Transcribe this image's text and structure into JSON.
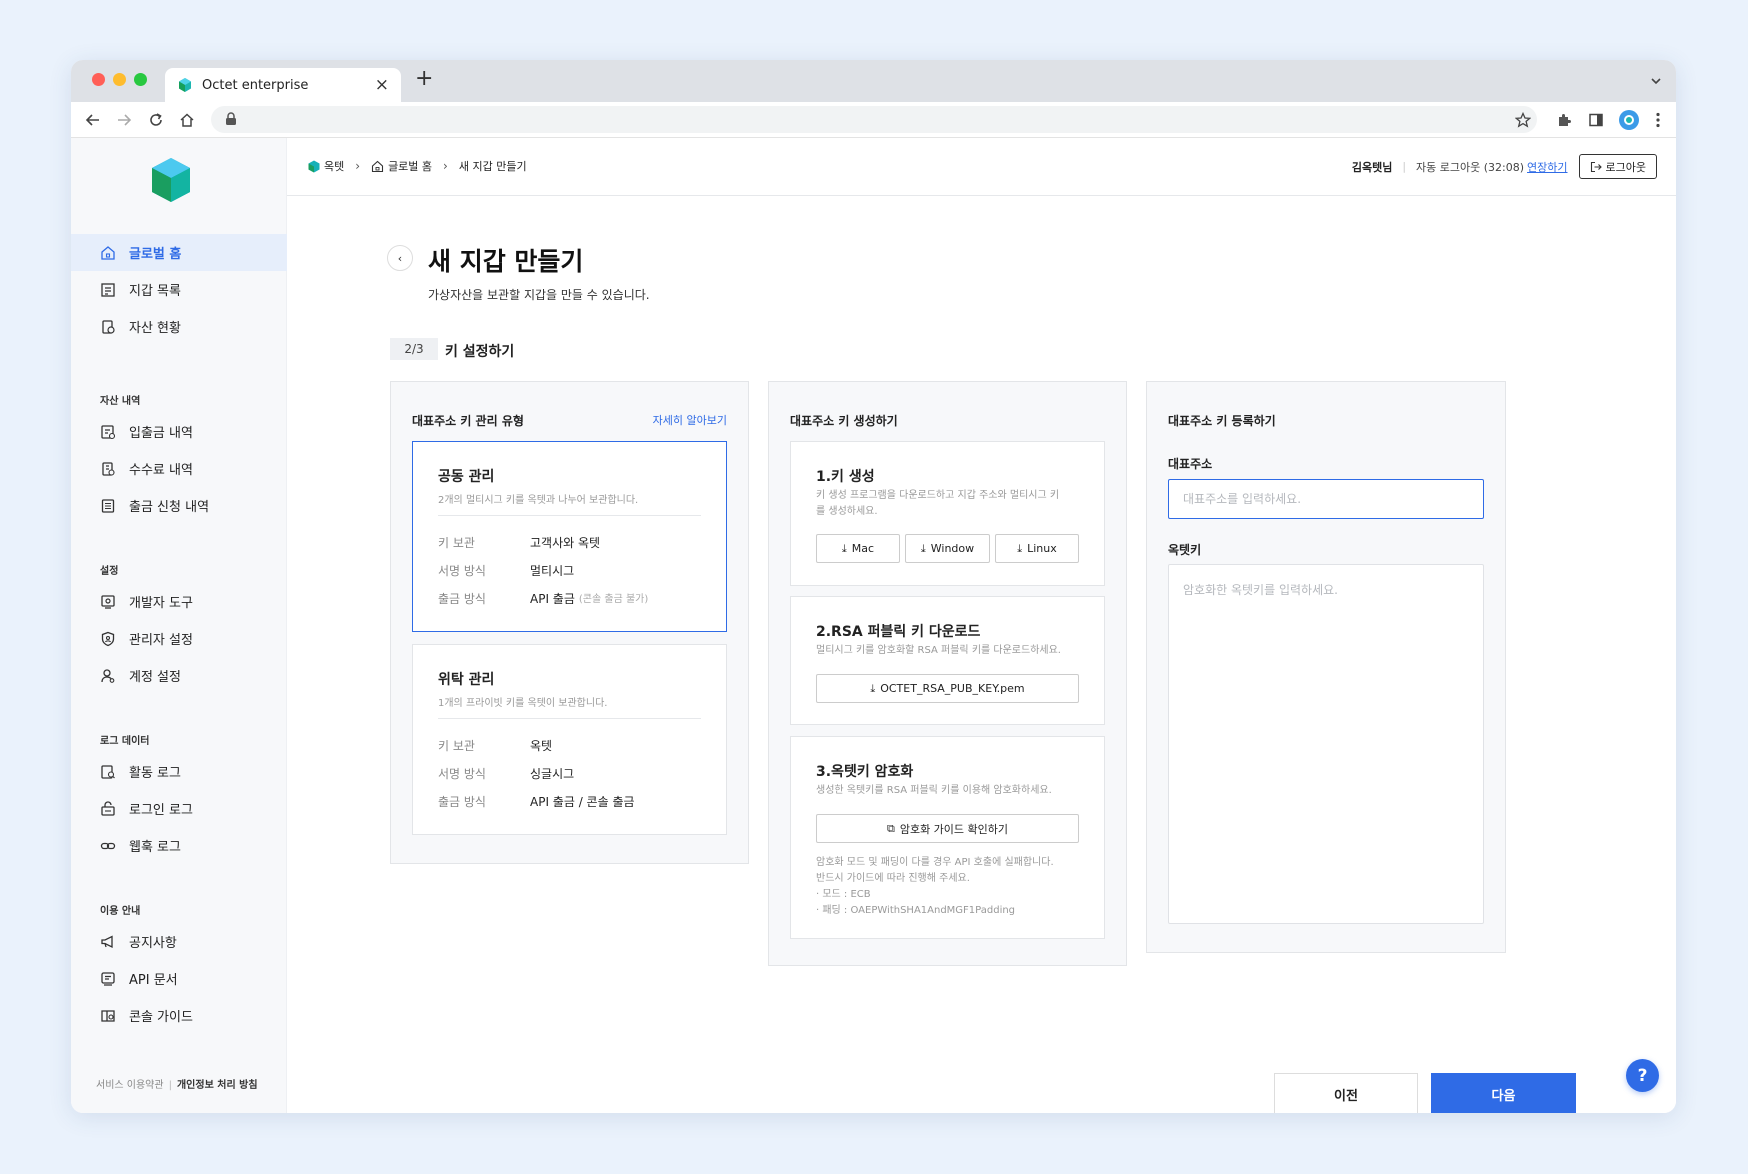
{
  "browser": {
    "tab_title": "Octet enterprise",
    "colors": {
      "close": "#ff5f57",
      "minimize": "#febc2e",
      "maximize": "#28c840"
    }
  },
  "sidebar": {
    "items_top": [
      {
        "label": "글로벌 홈",
        "icon": "home-icon",
        "active": true
      },
      {
        "label": "지갑 목록",
        "icon": "list-icon"
      },
      {
        "label": "자산 현황",
        "icon": "asset-icon"
      }
    ],
    "sections": [
      {
        "title": "자산 내역",
        "items": [
          {
            "label": "입출금 내역",
            "icon": "transfer-icon"
          },
          {
            "label": "수수료 내역",
            "icon": "fee-icon"
          },
          {
            "label": "출금 신청 내역",
            "icon": "request-icon"
          }
        ]
      },
      {
        "title": "설정",
        "items": [
          {
            "label": "개발자 도구",
            "icon": "developer-icon"
          },
          {
            "label": "관리자 설정",
            "icon": "shield-icon"
          },
          {
            "label": "계정 설정",
            "icon": "user-icon"
          }
        ]
      },
      {
        "title": "로그 데이터",
        "items": [
          {
            "label": "활동 로그",
            "icon": "activity-icon"
          },
          {
            "label": "로그인 로그",
            "icon": "login-icon"
          },
          {
            "label": "웹훅 로그",
            "icon": "link-icon"
          }
        ]
      },
      {
        "title": "이용 안내",
        "items": [
          {
            "label": "공지사항",
            "icon": "megaphone-icon"
          },
          {
            "label": "API 문서",
            "icon": "doc-icon"
          },
          {
            "label": "콘솔 가이드",
            "icon": "guide-icon"
          }
        ]
      }
    ],
    "footer": {
      "terms": "서비스 이용약관",
      "privacy": "개인정보 처리 방침"
    }
  },
  "topbar": {
    "breadcrumb": [
      "옥텟",
      "글로벌 홈",
      "새 지갑 만들기"
    ],
    "user_name": "김옥텟님",
    "auto_logout": "자동 로그아웃 (32:08)",
    "extend": "연장하기",
    "logout": "로그아웃"
  },
  "page": {
    "title": "새 지갑 만들기",
    "subtitle": "가상자산을 보관할 지갑을 만들 수 있습니다.",
    "step": "2/3",
    "step_title": "키 설정하기"
  },
  "panel1": {
    "title": "대표주소 키 관리 유형",
    "link": "자세히 알아보기",
    "cards": [
      {
        "title": "공동 관리",
        "desc": "2개의 멀티시그 키를 옥텟과 나누어 보관합니다.",
        "rows": [
          {
            "k": "키 보관",
            "v": "고객사와 옥텟",
            "note": ""
          },
          {
            "k": "서명 방식",
            "v": "멀티시그",
            "note": ""
          },
          {
            "k": "출금 방식",
            "v": "API 출금",
            "note": "(콘솔 출금 불가)"
          }
        ]
      },
      {
        "title": "위탁 관리",
        "desc": "1개의 프라이빗 키를 옥텟이 보관합니다.",
        "rows": [
          {
            "k": "키 보관",
            "v": "옥텟",
            "note": ""
          },
          {
            "k": "서명 방식",
            "v": "싱글시그",
            "note": ""
          },
          {
            "k": "출금 방식",
            "v": "API 출금 / 콘솔 출금",
            "note": ""
          }
        ]
      }
    ]
  },
  "panel2": {
    "title": "대표주소 키 생성하기",
    "step1": {
      "title": "1.키 생성",
      "desc1": "키 생성 프로그램을 다운로드하고 지갑 주소와 멀티시그 키",
      "desc2": "를 생성하세요.",
      "buttons": [
        "Mac",
        "Window",
        "Linux"
      ]
    },
    "step2": {
      "title": "2.RSA 퍼블릭 키 다운로드",
      "desc": "멀티시그 키를 암호화할 RSA 퍼블릭 키를 다운로드하세요.",
      "button": "OCTET_RSA_PUB_KEY.pem"
    },
    "step3": {
      "title": "3.옥텟키 암호화",
      "desc": "생성한 옥텟키를 RSA 퍼블릭 키를 이용해 암호화하세요.",
      "button": "암호화 가이드 확인하기",
      "notes": [
        "암호화 모드 및 패딩이 다를 경우 API 호출에 실패합니다.",
        "반드시 가이드에 따라 진행해 주세요.",
        "· 모드 : ECB",
        "· 패딩 : OAEPWithSHA1AndMGF1Padding"
      ]
    }
  },
  "panel3": {
    "title": "대표주소 키 등록하기",
    "address_label": "대표주소",
    "address_placeholder": "대표주소를 입력하세요.",
    "octetkey_label": "옥텟키",
    "octetkey_placeholder": "암호화한 옥텟키를 입력하세요."
  },
  "actions": {
    "prev": "이전",
    "next": "다음",
    "help": "?"
  },
  "colors": {
    "primary": "#2f6be6"
  }
}
